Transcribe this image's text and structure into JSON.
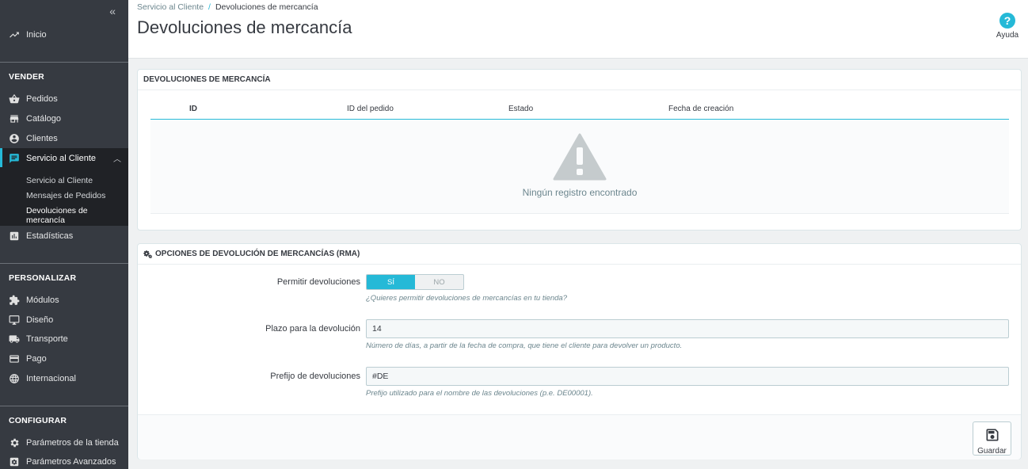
{
  "sidebar": {
    "collapse_glyph": "«",
    "top_item": "Inicio",
    "sections": {
      "vender": "VENDER",
      "personalizar": "PERSONALIZAR",
      "configurar": "CONFIGURAR"
    },
    "vender_items": [
      "Pedidos",
      "Catálogo",
      "Clientes",
      "Servicio al Cliente"
    ],
    "sub_items": [
      "Servicio al Cliente",
      "Mensajes de Pedidos",
      "Devoluciones de mercancía"
    ],
    "stats_item": "Estadísticas",
    "personalizar_items": [
      "Módulos",
      "Diseño",
      "Transporte",
      "Pago",
      "Internacional"
    ],
    "configurar_items": [
      "Parámetros de la tienda",
      "Parámetros Avanzados"
    ]
  },
  "header": {
    "breadcrumb_parent": "Servicio al Cliente",
    "breadcrumb_sep": "/",
    "breadcrumb_current": "Devoluciones de mercancía",
    "title": "Devoluciones de mercancía",
    "help_label": "Ayuda"
  },
  "returns_panel": {
    "title": "DEVOLUCIONES DE MERCANCÍA",
    "columns": [
      "ID",
      "ID del pedido",
      "Estado",
      "Fecha de creación"
    ],
    "empty_text": "Ningún registro encontrado"
  },
  "options_panel": {
    "title": "OPCIONES DE DEVOLUCIÓN DE MERCANCÍAS (RMA)",
    "allow_label": "Permitir devoluciones",
    "toggle_yes": "SÍ",
    "toggle_no": "NO",
    "toggle_selected": "SÍ",
    "allow_help": "¿Quieres permitir devoluciones de mercancías en tu tienda?",
    "deadline_label": "Plazo para la devolución",
    "deadline_value": "14",
    "deadline_help": "Número de días, a partir de la fecha de compra, que tiene el cliente para devolver un producto.",
    "prefix_label": "Prefijo de devoluciones",
    "prefix_value": "#DE",
    "prefix_help": "Prefijo utilizado para el nombre de las devoluciones (p.e. DE00001).",
    "save_label": "Guardar"
  },
  "colors": {
    "accent": "#25b9d7",
    "sidebar_bg": "#363a41",
    "sidebar_active_bg": "#202226"
  }
}
